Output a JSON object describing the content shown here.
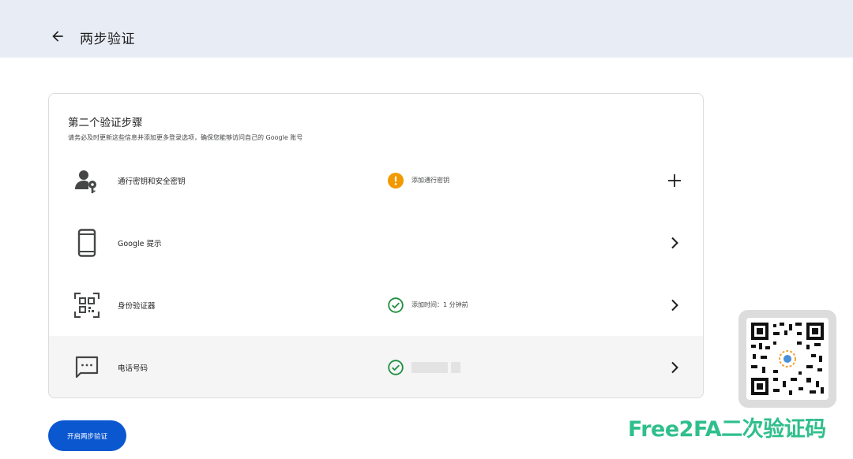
{
  "header": {
    "title": "两步验证"
  },
  "card": {
    "title": "第二个验证步骤",
    "subtitle": "请务必及时更新这些信息并添加更多登录选项，确保您能够访问自己的 Google 账号"
  },
  "rows": [
    {
      "label": "通行密钥和安全密钥",
      "status": "添加通行密钥",
      "status_icon": "warning-icon",
      "action_icon": "plus-icon"
    },
    {
      "label": "Google 提示",
      "status": "",
      "status_icon": "",
      "action_icon": "chevron-right-icon"
    },
    {
      "label": "身份验证器",
      "status": "添加时间：1 分钟前",
      "status_icon": "check-circle-icon",
      "action_icon": "chevron-right-icon"
    },
    {
      "label": "电话号码",
      "status": "",
      "status_icon": "check-circle-icon",
      "action_icon": "chevron-right-icon"
    }
  ],
  "primary_button": {
    "label": "开启两步验证"
  },
  "watermark": {
    "text": "Free2FA二次验证码"
  },
  "colors": {
    "accent": "#0b57d0",
    "warning": "#f29900",
    "success": "#1e8e3e",
    "header_bg": "#e8ecf5",
    "watermark": "#2fbf8c"
  }
}
